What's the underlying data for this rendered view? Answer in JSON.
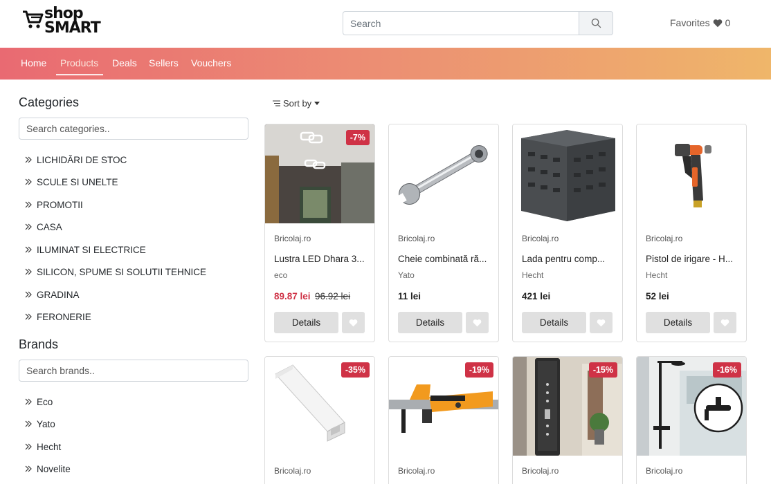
{
  "header": {
    "logo_line1": "shop",
    "logo_line2": "SMART",
    "search_placeholder": "Search",
    "favorites_label": "Favorites",
    "favorites_count": "0"
  },
  "nav": {
    "items": [
      "Home",
      "Products",
      "Deals",
      "Sellers",
      "Vouchers"
    ],
    "active": "Products"
  },
  "categories": {
    "title": "Categories",
    "search_placeholder": "Search categories..",
    "items": [
      "LICHIDĂRI DE STOC",
      "SCULE SI UNELTE",
      "PROMOTII",
      "CASA",
      "ILUMINAT SI ELECTRICE",
      "SILICON, SPUME SI SOLUTII TEHNICE",
      "GRADINA",
      "FERONERIE"
    ]
  },
  "brands": {
    "title": "Brands",
    "search_placeholder": "Search brands..",
    "items": [
      "Eco",
      "Yato",
      "Hecht",
      "Novelite"
    ]
  },
  "sort": {
    "label": "Sort by"
  },
  "products": [
    {
      "seller": "Bricolaj.ro",
      "name": "Lustra LED Dhara 3...",
      "brand": "eco",
      "price": "89.87 lei",
      "old_price": "96.92 lei",
      "badge": "-7%",
      "details": "Details"
    },
    {
      "seller": "Bricolaj.ro",
      "name": "Cheie combinată ră...",
      "brand": "Yato",
      "price": "11 lei",
      "details": "Details"
    },
    {
      "seller": "Bricolaj.ro",
      "name": "Lada pentru comp...",
      "brand": "Hecht",
      "price": "421 lei",
      "details": "Details"
    },
    {
      "seller": "Bricolaj.ro",
      "name": "Pistol de irigare - H...",
      "brand": "Hecht",
      "price": "52 lei",
      "details": "Details"
    },
    {
      "seller": "Bricolaj.ro",
      "badge": "-35%"
    },
    {
      "seller": "Bricolaj.ro",
      "badge": "-19%"
    },
    {
      "seller": "Bricolaj.ro",
      "badge": "-15%"
    },
    {
      "seller": "Bricolaj.ro",
      "badge": "-16%"
    }
  ],
  "colors": {
    "nav_gradient_start": "#e96a72",
    "nav_gradient_end": "#efb66a",
    "sale_red": "#cf3246"
  }
}
